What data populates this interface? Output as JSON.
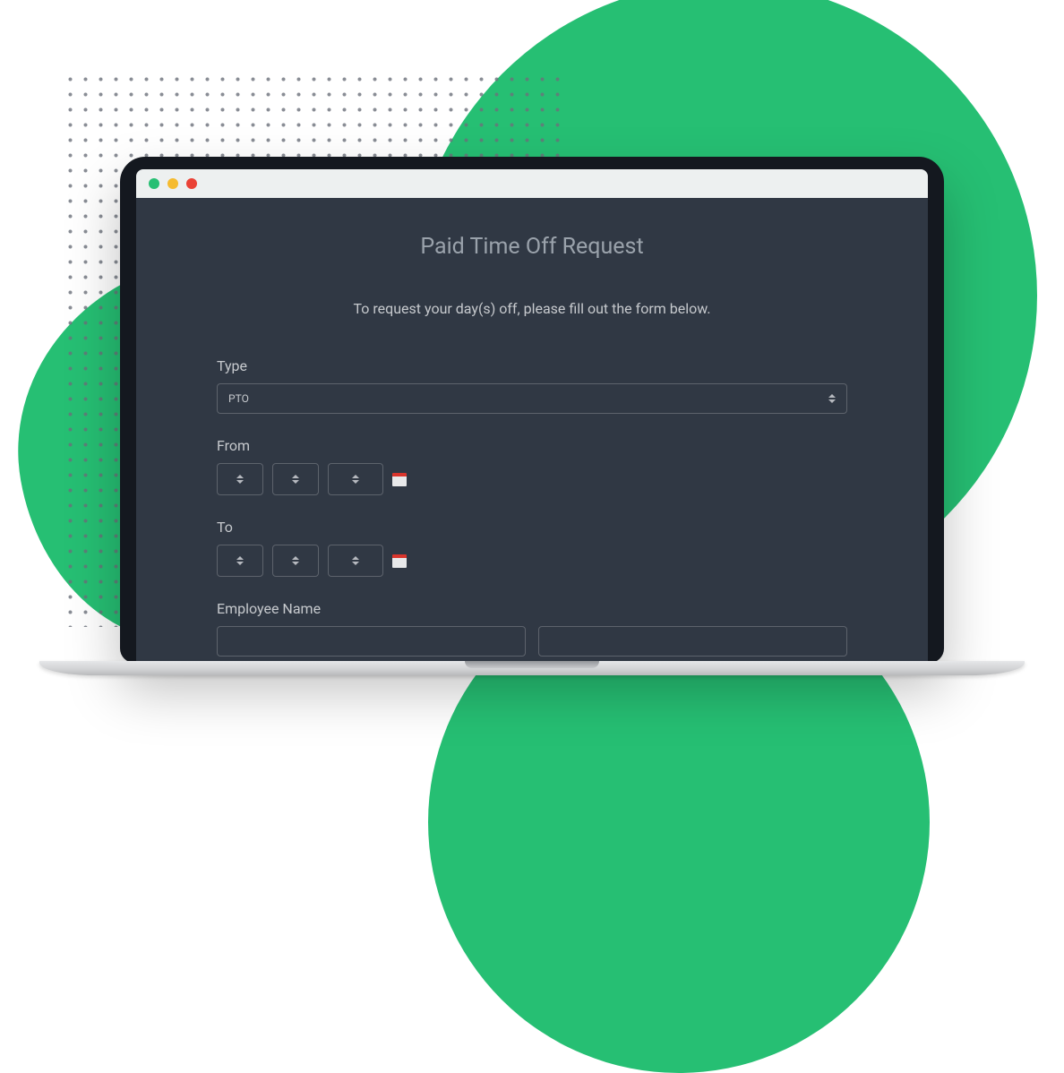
{
  "form": {
    "title": "Paid Time Off Request",
    "subtitle": "To request your day(s) off, please fill out the form below.",
    "type_label": "Type",
    "type_value": "PTO",
    "from_label": "From",
    "to_label": "To",
    "employee_name_label": "Employee Name"
  }
}
